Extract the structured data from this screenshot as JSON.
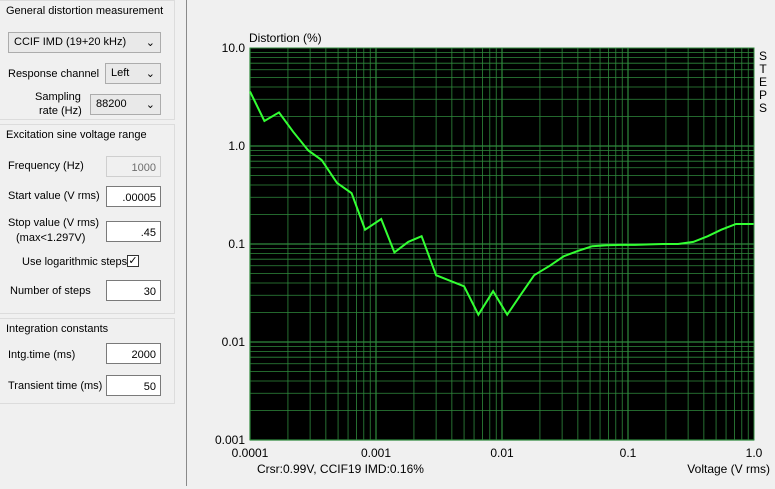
{
  "general": {
    "title": "General distortion measurement",
    "measurement_type": "CCIF IMD (19+20 kHz)",
    "response_channel_label": "Response channel",
    "response_channel": "Left",
    "sampling_label_1": "Sampling",
    "sampling_label_2": "rate (Hz)",
    "sampling_rate": "88200"
  },
  "excitation": {
    "title": "Excitation sine voltage range",
    "frequency_label": "Frequency (Hz)",
    "frequency": "1000",
    "start_label": "Start value (V rms)",
    "start": ".00005",
    "stop_label_1": "Stop value (V rms)",
    "stop_label_2": "(max<1.297V)",
    "stop": ".45",
    "log_steps_label": "Use logarithmic steps",
    "log_steps_checked": "✓",
    "steps_label": "Number of steps",
    "steps": "30"
  },
  "integration": {
    "title": "Integration constants",
    "intg_label": "Intg.time (ms)",
    "intg": "2000",
    "transient_label": "Transient time (ms)",
    "transient": "50"
  },
  "chart_data": {
    "type": "line",
    "ylabel": "Distortion (%)",
    "xlabel": "Voltage (V rms)",
    "right_label": [
      "S",
      "T",
      "E",
      "P",
      "S"
    ],
    "cursor_text": "Crsr:0.99V, CCIF19 IMD:0.16%",
    "x_scale": "log",
    "y_scale": "log",
    "xlim": [
      0.0001,
      1.0
    ],
    "ylim": [
      0.001,
      10.0
    ],
    "x_ticks": [
      "0.0001",
      "0.001",
      "0.01",
      "0.1",
      "1.0"
    ],
    "y_ticks": [
      "10.0",
      "1.0",
      "0.1",
      "0.01",
      "0.001"
    ],
    "grid": true,
    "background_color": "#000000",
    "grid_color": "#2f8a3d",
    "line_color": "#33ff33",
    "series": [
      {
        "x": [
          0.0001,
          0.00013,
          0.00017,
          0.00022,
          0.00029,
          0.00037,
          0.00049,
          0.00064,
          0.00082,
          0.0011,
          0.0014,
          0.0018,
          0.0023,
          0.003,
          0.0039,
          0.005,
          0.0065,
          0.0085,
          0.011,
          0.014,
          0.018,
          0.024,
          0.031,
          0.04,
          0.052,
          0.068,
          0.088,
          0.11,
          0.15,
          0.19,
          0.25,
          0.33,
          0.43,
          0.55,
          0.72,
          0.99
        ],
        "y": [
          3.6,
          1.8,
          2.2,
          1.4,
          0.9,
          0.72,
          0.42,
          0.33,
          0.14,
          0.18,
          0.082,
          0.105,
          0.12,
          0.048,
          0.042,
          0.037,
          0.019,
          0.033,
          0.019,
          0.03,
          0.048,
          0.06,
          0.075,
          0.085,
          0.095,
          0.097,
          0.098,
          0.098,
          0.099,
          0.1,
          0.1,
          0.105,
          0.12,
          0.14,
          0.16,
          0.16
        ]
      }
    ]
  }
}
